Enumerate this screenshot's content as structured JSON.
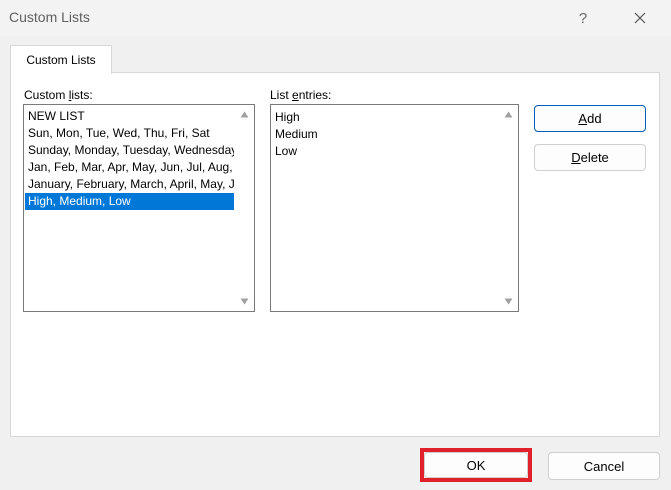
{
  "window": {
    "title": "Custom Lists",
    "help_glyph": "?",
    "close_icon": "close-icon"
  },
  "tabs": [
    {
      "label": "Custom Lists",
      "active": true
    }
  ],
  "custom_lists": {
    "label_pre": "Custom ",
    "label_mnemonic": "l",
    "label_post": "ists:",
    "items": [
      {
        "label": "NEW LIST",
        "selected": false
      },
      {
        "label": "Sun, Mon, Tue, Wed, Thu, Fri, Sat",
        "selected": false
      },
      {
        "label": "Sunday, Monday, Tuesday, Wednesday, Thursday, Friday, Saturday",
        "selected": false
      },
      {
        "label": "Jan, Feb, Mar, Apr, May, Jun, Jul, Aug, Sep, Oct, Nov, Dec",
        "selected": false
      },
      {
        "label": "January, February, March, April, May, June, July, August, September, October, November, December",
        "selected": false
      },
      {
        "label": "High, Medium, Low",
        "selected": true
      }
    ]
  },
  "list_entries": {
    "label_pre": "List ",
    "label_mnemonic": "e",
    "label_post": "ntries:",
    "lines": [
      "High",
      "Medium",
      "Low"
    ]
  },
  "buttons": {
    "add": {
      "mnemonic": "A",
      "rest": "dd"
    },
    "delete": {
      "mnemonic": "D",
      "rest": "elete"
    },
    "ok": "OK",
    "cancel": "Cancel"
  },
  "colors": {
    "selection": "#0078d7",
    "primary_border": "#005fb8",
    "highlight": "#e0202a"
  }
}
